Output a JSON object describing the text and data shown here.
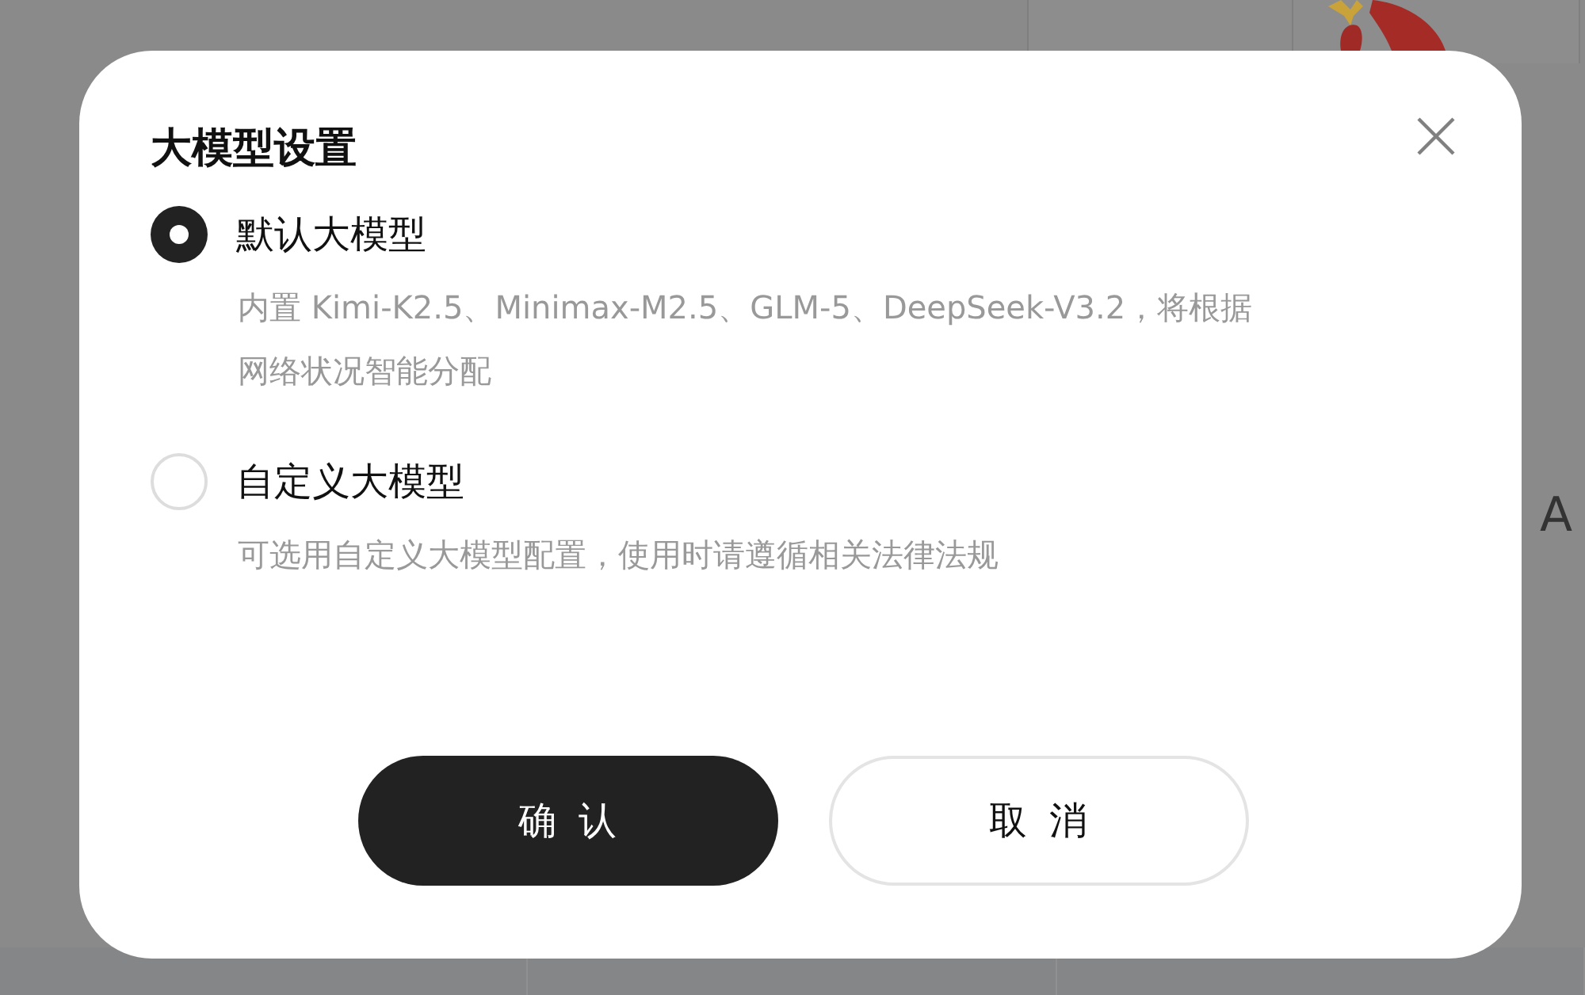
{
  "background": {
    "partial_text": "A"
  },
  "dialog": {
    "title": "大模型设置",
    "options": [
      {
        "label": "默认大模型",
        "description": "内置 Kimi-K2.5、Minimax-M2.5、GLM-5、DeepSeek-V3.2，将根据网络状况智能分配",
        "selected": true
      },
      {
        "label": "自定义大模型",
        "description": "可选用自定义大模型配置，使用时请遵循相关法律法规",
        "selected": false
      }
    ],
    "buttons": [
      {
        "label": "确认",
        "kind": "primary"
      },
      {
        "label": "取消",
        "kind": "secondary"
      }
    ]
  }
}
